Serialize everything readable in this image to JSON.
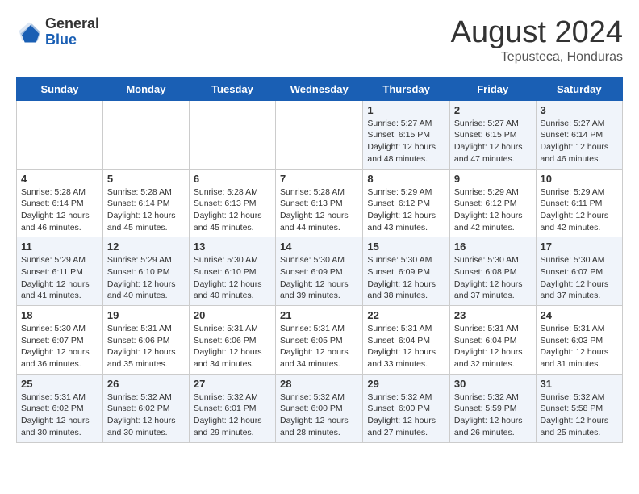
{
  "header": {
    "logo_general": "General",
    "logo_blue": "Blue",
    "main_title": "August 2024",
    "subtitle": "Tepusteca, Honduras"
  },
  "calendar": {
    "days_of_week": [
      "Sunday",
      "Monday",
      "Tuesday",
      "Wednesday",
      "Thursday",
      "Friday",
      "Saturday"
    ],
    "weeks": [
      [
        {
          "day": "",
          "text": ""
        },
        {
          "day": "",
          "text": ""
        },
        {
          "day": "",
          "text": ""
        },
        {
          "day": "",
          "text": ""
        },
        {
          "day": "1",
          "text": "Sunrise: 5:27 AM\nSunset: 6:15 PM\nDaylight: 12 hours\nand 48 minutes."
        },
        {
          "day": "2",
          "text": "Sunrise: 5:27 AM\nSunset: 6:15 PM\nDaylight: 12 hours\nand 47 minutes."
        },
        {
          "day": "3",
          "text": "Sunrise: 5:27 AM\nSunset: 6:14 PM\nDaylight: 12 hours\nand 46 minutes."
        }
      ],
      [
        {
          "day": "4",
          "text": "Sunrise: 5:28 AM\nSunset: 6:14 PM\nDaylight: 12 hours\nand 46 minutes."
        },
        {
          "day": "5",
          "text": "Sunrise: 5:28 AM\nSunset: 6:14 PM\nDaylight: 12 hours\nand 45 minutes."
        },
        {
          "day": "6",
          "text": "Sunrise: 5:28 AM\nSunset: 6:13 PM\nDaylight: 12 hours\nand 45 minutes."
        },
        {
          "day": "7",
          "text": "Sunrise: 5:28 AM\nSunset: 6:13 PM\nDaylight: 12 hours\nand 44 minutes."
        },
        {
          "day": "8",
          "text": "Sunrise: 5:29 AM\nSunset: 6:12 PM\nDaylight: 12 hours\nand 43 minutes."
        },
        {
          "day": "9",
          "text": "Sunrise: 5:29 AM\nSunset: 6:12 PM\nDaylight: 12 hours\nand 42 minutes."
        },
        {
          "day": "10",
          "text": "Sunrise: 5:29 AM\nSunset: 6:11 PM\nDaylight: 12 hours\nand 42 minutes."
        }
      ],
      [
        {
          "day": "11",
          "text": "Sunrise: 5:29 AM\nSunset: 6:11 PM\nDaylight: 12 hours\nand 41 minutes."
        },
        {
          "day": "12",
          "text": "Sunrise: 5:29 AM\nSunset: 6:10 PM\nDaylight: 12 hours\nand 40 minutes."
        },
        {
          "day": "13",
          "text": "Sunrise: 5:30 AM\nSunset: 6:10 PM\nDaylight: 12 hours\nand 40 minutes."
        },
        {
          "day": "14",
          "text": "Sunrise: 5:30 AM\nSunset: 6:09 PM\nDaylight: 12 hours\nand 39 minutes."
        },
        {
          "day": "15",
          "text": "Sunrise: 5:30 AM\nSunset: 6:09 PM\nDaylight: 12 hours\nand 38 minutes."
        },
        {
          "day": "16",
          "text": "Sunrise: 5:30 AM\nSunset: 6:08 PM\nDaylight: 12 hours\nand 37 minutes."
        },
        {
          "day": "17",
          "text": "Sunrise: 5:30 AM\nSunset: 6:07 PM\nDaylight: 12 hours\nand 37 minutes."
        }
      ],
      [
        {
          "day": "18",
          "text": "Sunrise: 5:30 AM\nSunset: 6:07 PM\nDaylight: 12 hours\nand 36 minutes."
        },
        {
          "day": "19",
          "text": "Sunrise: 5:31 AM\nSunset: 6:06 PM\nDaylight: 12 hours\nand 35 minutes."
        },
        {
          "day": "20",
          "text": "Sunrise: 5:31 AM\nSunset: 6:06 PM\nDaylight: 12 hours\nand 34 minutes."
        },
        {
          "day": "21",
          "text": "Sunrise: 5:31 AM\nSunset: 6:05 PM\nDaylight: 12 hours\nand 34 minutes."
        },
        {
          "day": "22",
          "text": "Sunrise: 5:31 AM\nSunset: 6:04 PM\nDaylight: 12 hours\nand 33 minutes."
        },
        {
          "day": "23",
          "text": "Sunrise: 5:31 AM\nSunset: 6:04 PM\nDaylight: 12 hours\nand 32 minutes."
        },
        {
          "day": "24",
          "text": "Sunrise: 5:31 AM\nSunset: 6:03 PM\nDaylight: 12 hours\nand 31 minutes."
        }
      ],
      [
        {
          "day": "25",
          "text": "Sunrise: 5:31 AM\nSunset: 6:02 PM\nDaylight: 12 hours\nand 30 minutes."
        },
        {
          "day": "26",
          "text": "Sunrise: 5:32 AM\nSunset: 6:02 PM\nDaylight: 12 hours\nand 30 minutes."
        },
        {
          "day": "27",
          "text": "Sunrise: 5:32 AM\nSunset: 6:01 PM\nDaylight: 12 hours\nand 29 minutes."
        },
        {
          "day": "28",
          "text": "Sunrise: 5:32 AM\nSunset: 6:00 PM\nDaylight: 12 hours\nand 28 minutes."
        },
        {
          "day": "29",
          "text": "Sunrise: 5:32 AM\nSunset: 6:00 PM\nDaylight: 12 hours\nand 27 minutes."
        },
        {
          "day": "30",
          "text": "Sunrise: 5:32 AM\nSunset: 5:59 PM\nDaylight: 12 hours\nand 26 minutes."
        },
        {
          "day": "31",
          "text": "Sunrise: 5:32 AM\nSunset: 5:58 PM\nDaylight: 12 hours\nand 25 minutes."
        }
      ]
    ]
  }
}
